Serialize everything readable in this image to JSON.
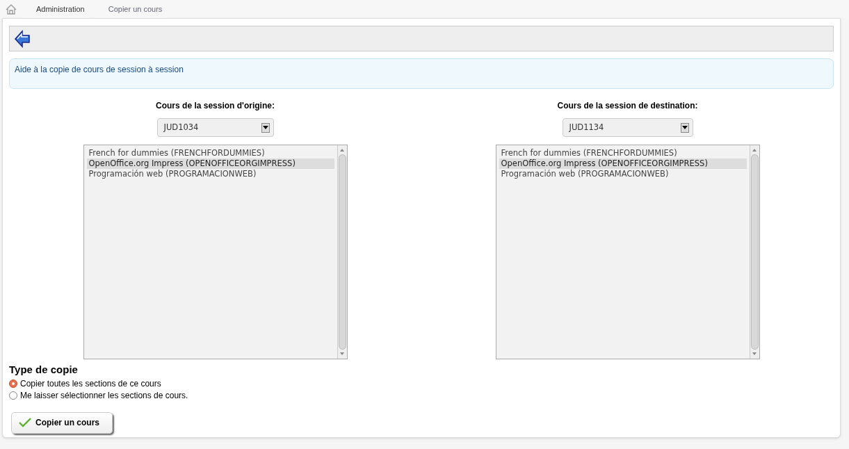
{
  "breadcrumb": [
    {
      "label": "Administration",
      "selected": false
    },
    {
      "label": "Copier un cours",
      "selected": true
    }
  ],
  "help_text": "Aide à la copie de cours de session à session",
  "sessions": [
    {
      "label": "Cours de la session d'origine:",
      "select_value": "JUD1034",
      "courses": [
        {
          "label": "French for dummies (FRENCHFORDUMMIES)",
          "selected": false
        },
        {
          "label": "OpenOffice.org Impress (OPENOFFICEORGIMPRESS)",
          "selected": true
        },
        {
          "label": "Programación web (PROGRAMACIONWEB)",
          "selected": false
        }
      ]
    },
    {
      "label": "Cours de la session de destination:",
      "select_value": "JUD1134",
      "courses": [
        {
          "label": "French for dummies (FRENCHFORDUMMIES)",
          "selected": false
        },
        {
          "label": "OpenOffice.org Impress (OPENOFFICEORGIMPRESS)",
          "selected": true
        },
        {
          "label": "Programación web (PROGRAMACIONWEB)",
          "selected": false
        }
      ]
    }
  ],
  "copy_type": {
    "title": "Type de copie",
    "options": [
      {
        "label": "Copier toutes les sections de ce cours",
        "selected": true
      },
      {
        "label": "Me laisser sélectionner les sections de cours.",
        "selected": false
      }
    ]
  },
  "submit_button": "Copier un cours"
}
